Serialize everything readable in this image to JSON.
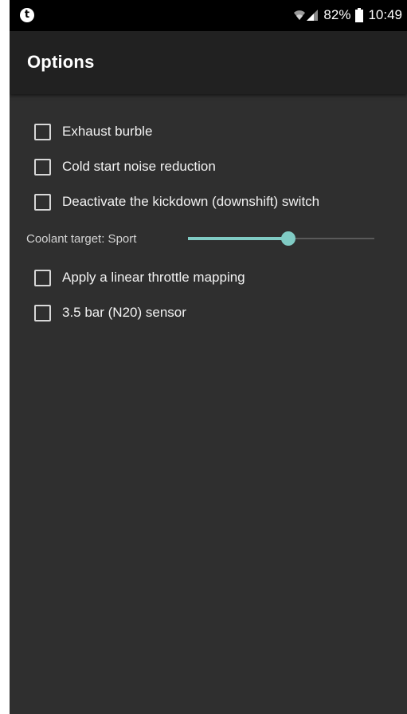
{
  "status_bar": {
    "app_icon": "tumblr-icon",
    "battery_percent": "82%",
    "time": "10:49",
    "icons": [
      "wifi-icon",
      "signal-icon",
      "battery-icon"
    ]
  },
  "app_bar": {
    "title": "Options"
  },
  "options": [
    {
      "label": "Exhaust burble",
      "checked": false
    },
    {
      "label": "Cold start noise reduction",
      "checked": false
    },
    {
      "label": "Deactivate the kickdown (downshift) switch",
      "checked": false
    }
  ],
  "slider": {
    "label": "Coolant target: Sport",
    "fill_fraction": 0.54,
    "accent_color": "#80cbc4"
  },
  "options_after": [
    {
      "label": "Apply a linear throttle mapping",
      "checked": false
    },
    {
      "label": "3.5 bar (N20) sensor",
      "checked": false
    }
  ],
  "colors": {
    "background": "#2f2f2f",
    "app_bar": "#212121",
    "status_bar": "#000000",
    "accent": "#80cbc4"
  }
}
